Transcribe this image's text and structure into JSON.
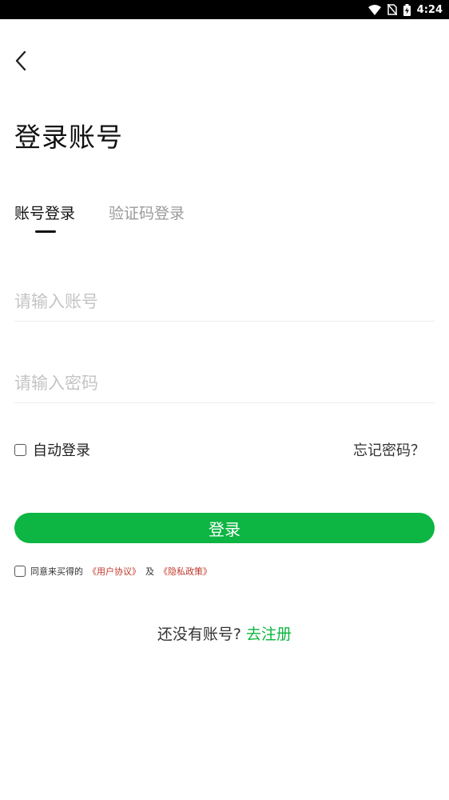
{
  "status_bar": {
    "time": "4:24",
    "icons": [
      "wifi-icon",
      "no-sim-icon",
      "battery-charging-icon"
    ]
  },
  "header": {
    "back_icon": "chevron-left-icon",
    "title": "登录账号"
  },
  "tabs": [
    {
      "label": "账号登录",
      "active": true
    },
    {
      "label": "验证码登录",
      "active": false
    }
  ],
  "form": {
    "account_placeholder": "请输入账号",
    "account_value": "",
    "password_placeholder": "请输入密码",
    "password_value": "",
    "remember_label": "自动登录",
    "remember_checked": false,
    "forgot_label": "忘记密码？",
    "login_label": "登录"
  },
  "agreement": {
    "prefix": "同意来买得的",
    "user_agreement": "《用户协议》",
    "conjunction": "及",
    "privacy_policy": "《隐私政策》",
    "checked": false
  },
  "register": {
    "prompt": "还没有账号? ",
    "link": "去注册"
  },
  "colors": {
    "accent": "#0db542",
    "policy_link": "#c0392b",
    "placeholder": "#c4c4c4",
    "inactive_tab": "#9a9a9a"
  }
}
